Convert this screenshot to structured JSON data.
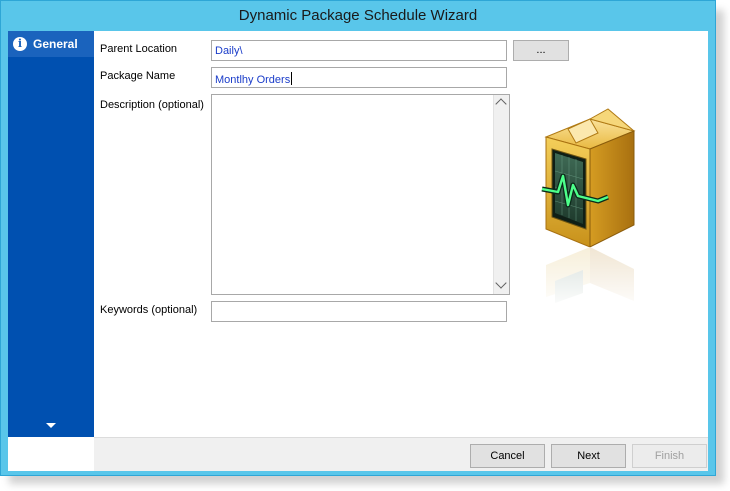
{
  "window": {
    "title": "Dynamic Package Schedule Wizard"
  },
  "sidebar": {
    "items": [
      {
        "label": "General",
        "icon": "info-icon"
      }
    ],
    "scroll_icon": "chevron-down-icon"
  },
  "form": {
    "parent_location": {
      "label": "Parent Location",
      "value": "Daily\\",
      "browse_label": "..."
    },
    "package_name": {
      "label": "Package Name",
      "value": "Montlhy Orders"
    },
    "description": {
      "label": "Description (optional)",
      "value": ""
    },
    "keywords": {
      "label": "Keywords (optional)",
      "value": ""
    }
  },
  "illustration": {
    "icon": "package-box-icon",
    "accent": "#e2b23a"
  },
  "footer": {
    "cancel_label": "Cancel",
    "next_label": "Next",
    "finish_label": "Finish"
  },
  "colors": {
    "titlebar": "#59c6ea",
    "sidebar": "#0050b0",
    "sidebar_selected": "#1a63bd"
  }
}
